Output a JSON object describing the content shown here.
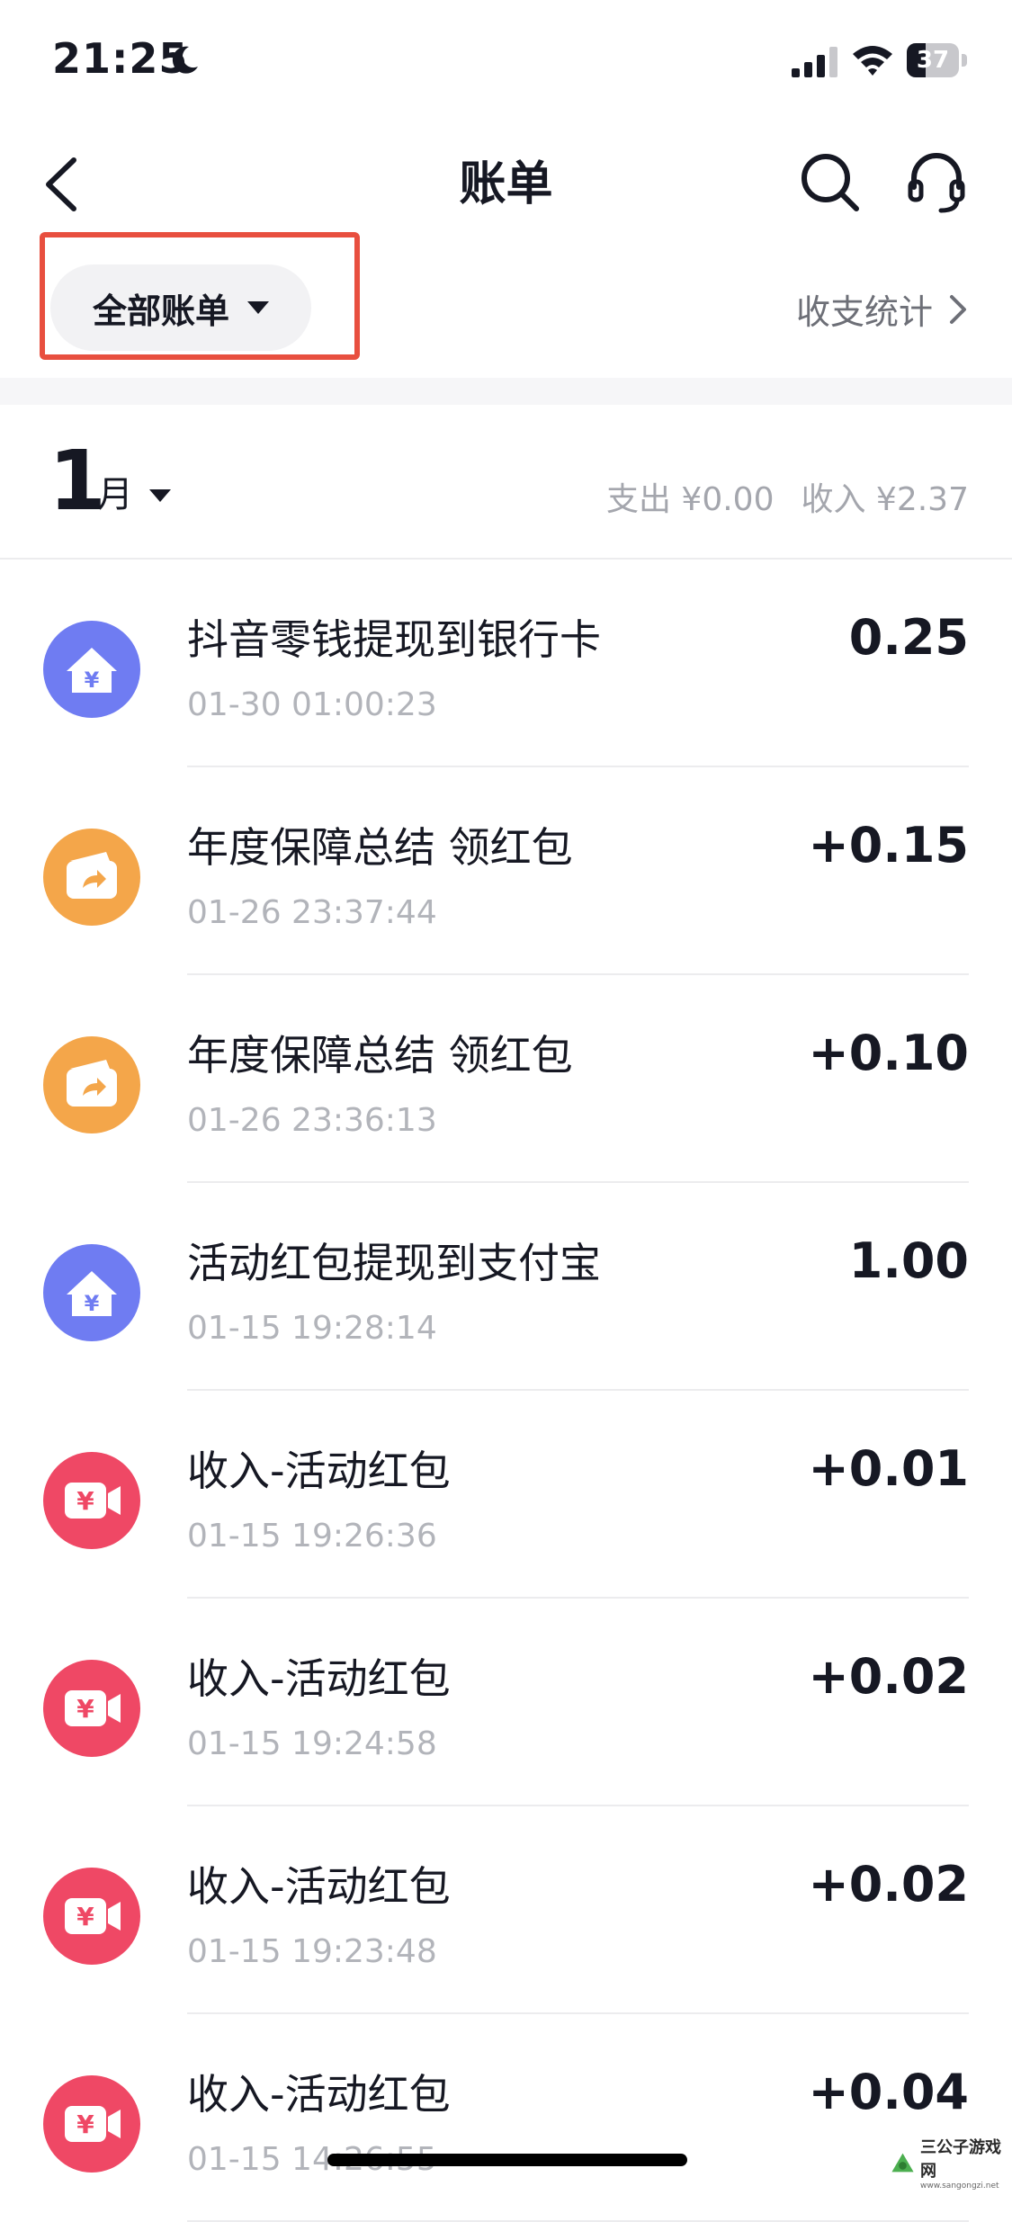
{
  "status_bar": {
    "time": "21:25",
    "battery": "37",
    "battery_level_percent": 37,
    "icons": [
      "moon-icon",
      "signal-icon",
      "wifi-icon",
      "battery-icon"
    ]
  },
  "nav": {
    "title": "账单",
    "icons": [
      "back-chevron-icon",
      "search-icon",
      "customer-service-icon"
    ]
  },
  "filter": {
    "label": "全部账单",
    "highlight_color": "#e84f3f"
  },
  "stats_link": "收支统计",
  "month": {
    "number": "1",
    "label": "月",
    "expense": "支出 ¥0.00",
    "income": "收入 ¥2.37"
  },
  "transactions": [
    {
      "title": "抖音零钱提现到银行卡",
      "time": "01-30 01:00:23",
      "amount": "0.25",
      "icon": "withdraw-house-icon",
      "icon_color": "#6f7cf2"
    },
    {
      "title": "年度保障总结 领红包",
      "time": "01-26 23:37:44",
      "amount": "+0.15",
      "icon": "wallet-share-icon",
      "icon_color": "#f4a64a"
    },
    {
      "title": "年度保障总结 领红包",
      "time": "01-26 23:36:13",
      "amount": "+0.10",
      "icon": "wallet-share-icon",
      "icon_color": "#f4a64a"
    },
    {
      "title": "活动红包提现到支付宝",
      "time": "01-15 19:28:14",
      "amount": "1.00",
      "icon": "withdraw-house-icon",
      "icon_color": "#6f7cf2"
    },
    {
      "title": "收入-活动红包",
      "time": "01-15 19:26:36",
      "amount": "+0.01",
      "icon": "video-yuan-icon",
      "icon_color": "#ef4865"
    },
    {
      "title": "收入-活动红包",
      "time": "01-15 19:24:58",
      "amount": "+0.02",
      "icon": "video-yuan-icon",
      "icon_color": "#ef4865"
    },
    {
      "title": "收入-活动红包",
      "time": "01-15 19:23:48",
      "amount": "+0.02",
      "icon": "video-yuan-icon",
      "icon_color": "#ef4865"
    },
    {
      "title": "收入-活动红包",
      "time": "01-15 14:26:55",
      "amount": "+0.04",
      "icon": "video-yuan-icon",
      "icon_color": "#ef4865"
    }
  ],
  "watermark": {
    "name": "三公子游戏网",
    "url": "www.sangongzi.net"
  }
}
